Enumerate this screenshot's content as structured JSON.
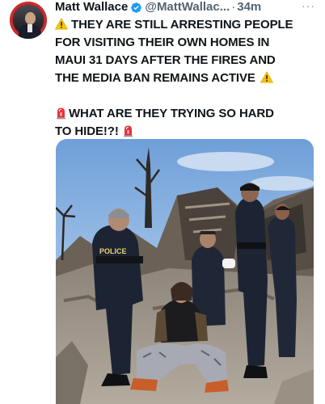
{
  "tweet": {
    "author_name": "Matt Wallace",
    "author_handle": "@MattWallac...",
    "separator": "·",
    "time": "34m",
    "more_label": "···",
    "lines_para1": [
      "THEY ARE STILL ARRESTING PEOPLE",
      "FOR VISITING THEIR OWN HOMES IN",
      "MAUI 31 DAYS AFTER THE FIRES AND",
      "THE MEDIA BAN REMAINS ACTIVE"
    ],
    "lines_para2": [
      "WHAT ARE THEY TRYING SO HARD",
      "TO HIDE!?!"
    ],
    "emoji_para1_start": "warning-emoji",
    "emoji_para1_end": "warning-emoji",
    "emoji_para2_start": "police-siren-emoji",
    "emoji_para2_end": "police-siren-emoji",
    "photo_label": "POLICE",
    "colors": {
      "verified_blue": "#1d9bf0",
      "text": "#0f1419",
      "secondary": "#536471",
      "warning_yellow": "#f5c400",
      "siren_red": "#e8333a",
      "avatar_ring": "#c62f2f"
    }
  }
}
